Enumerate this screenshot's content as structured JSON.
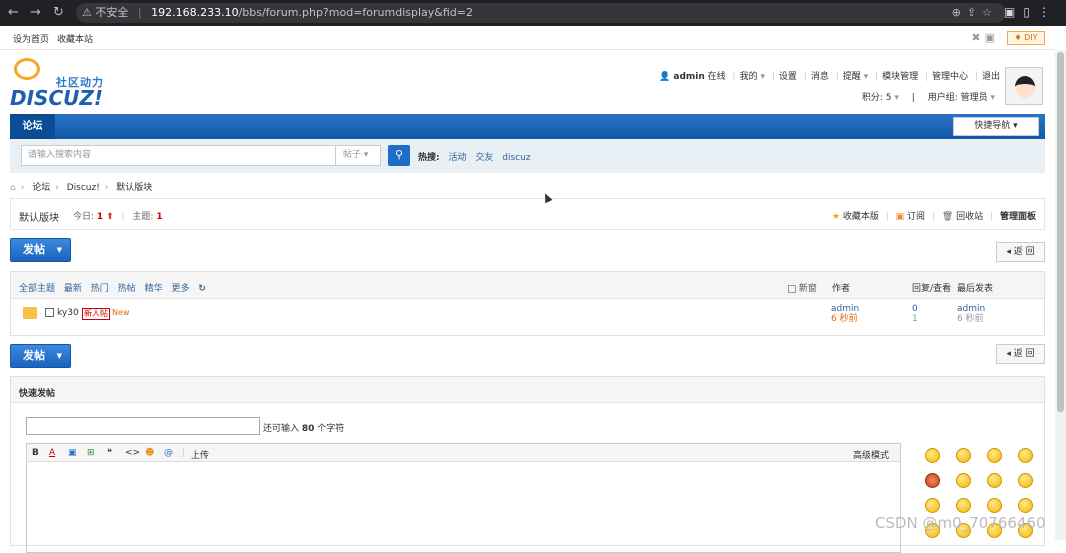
{
  "browser": {
    "insecure_label": "不安全",
    "url_host": "192.168.233.10",
    "url_path": "/bbs/forum.php?mod=forumdisplay&fid=2"
  },
  "topbar": {
    "set_home": "设为首页",
    "favorite_site": "收藏本站",
    "diy": "♦ DIY"
  },
  "logo": {
    "cn": "社区动力",
    "en": "DISCUZ!"
  },
  "user": {
    "name": "admin",
    "online": "在线",
    "links": [
      "我的",
      "设置",
      "消息",
      "提醒",
      "模块管理",
      "管理中心",
      "退出"
    ],
    "points": "积分: 5",
    "group": "用户组: 管理员"
  },
  "nav": {
    "tab": "论坛",
    "quick": "快捷导航"
  },
  "search": {
    "placeholder": "请输入搜索内容",
    "type": "帖子",
    "hot_label": "热搜:",
    "hot": [
      "活动",
      "交友",
      "discuz"
    ]
  },
  "breadcrumb": [
    "论坛",
    "Discuz!",
    "默认版块"
  ],
  "forum": {
    "name": "默认版块",
    "today_label": "今日:",
    "today": "1",
    "topics_label": "主题:",
    "topics": "1",
    "favorite": "收藏本版",
    "subscribe": "订阅",
    "recycle": "回收站",
    "manage": "管理面板"
  },
  "post_button": "发帖",
  "back_button": "返 回",
  "threadlist": {
    "filters": [
      "全部主题",
      "最新",
      "热门",
      "热帖",
      "精华",
      "更多"
    ],
    "new_label": "新窗",
    "col_author": "作者",
    "col_replies": "回复/查看",
    "col_last": "最后发表",
    "rows": [
      {
        "title": "ky30",
        "tag": "新人帖",
        "new": "New",
        "author": "admin",
        "author_time": "6 秒前",
        "replies": "0",
        "views": "1",
        "last_author": "admin",
        "last_time": "6 秒前"
      }
    ]
  },
  "quick_post": {
    "title": "快速发帖",
    "hint_prefix": "还可输入",
    "hint_count": "80",
    "hint_suffix": "个字符",
    "upload": "上传",
    "advanced": "高级模式"
  },
  "watermark": "CSDN @m0_70766460"
}
